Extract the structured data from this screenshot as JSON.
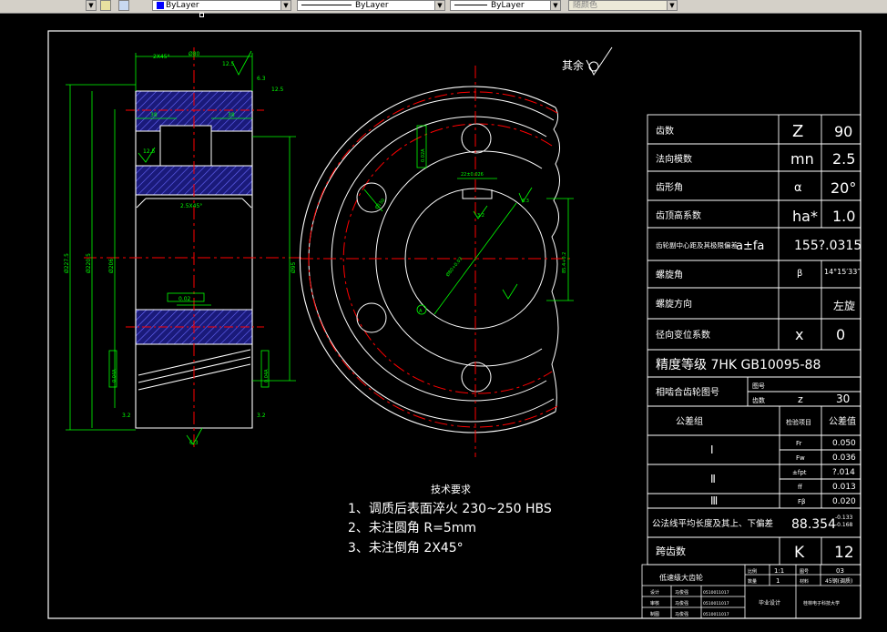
{
  "toolbar": {
    "color_layer": "ByLayer",
    "linetype": "ByLayer",
    "lineweight": "ByLayer",
    "plotstyle": "随颜色"
  },
  "drawing": {
    "surface_symbol_label": "其余",
    "section_dims": {
      "chamfer_top": "2X45°",
      "width_top": "Ø80",
      "rough_top": "12.5",
      "rough_right": "6.3",
      "rough_right2": "12.5",
      "hub_left": "38",
      "hub_right": "38",
      "rough_mid": "12.5",
      "chamfer_inner": "2.5X45°",
      "dia_outer": "Ø227.5",
      "dia_root": "Ø220.5",
      "dia_web": "Ø206",
      "dia_hub": "Ø95",
      "runout_box": "0.02",
      "bottom_rough": "6.3",
      "left_rough": "3.2",
      "right_rough": "3.2",
      "left_tol": "0.04A",
      "right_tol": "0.04A"
    },
    "front_dims": {
      "key_width": "22±0.026",
      "rough_key": "3.2",
      "rough_side": "6.3",
      "hole_dia": "Ø80+0.03",
      "key_depth": "85.4+0.2",
      "datum": "A",
      "hole_pos": "Ø150",
      "tol_box": "0.02A"
    },
    "tech_requirements": {
      "title": "技术要求",
      "items": [
        "1、调质后表面淬火 230~250 HBS",
        "2、未注圆角 R=5mm",
        "3、未注倒角 2X45°"
      ]
    }
  },
  "params_table": {
    "rows": [
      {
        "label": "齿数",
        "symbol": "Z",
        "value": "90"
      },
      {
        "label": "法向模数",
        "symbol": "mn",
        "value": "2.5"
      },
      {
        "label": "齿形角",
        "symbol": "α",
        "value": "20°"
      },
      {
        "label": "齿顶高系数",
        "symbol": "ha*",
        "value": "1.0"
      },
      {
        "label": "齿轮副中心距及其极限偏差",
        "symbol": "a±fa",
        "value": "155?.0315"
      },
      {
        "label": "螺旋角",
        "symbol": "β",
        "value": "14°15′33″"
      },
      {
        "label": "螺旋方向",
        "symbol": "",
        "value": "左旋"
      },
      {
        "label": "径向变位系数",
        "symbol": "x",
        "value": "0"
      }
    ],
    "precision": "精度等级   7HK GB10095-88",
    "mating": {
      "label": "相啮合齿轮图号",
      "sub1": "图号",
      "sub2": "齿数",
      "z": "z",
      "z_value": "30"
    },
    "tolerance_header": {
      "group": "公差组",
      "item": "检验项目",
      "value": "公差值"
    },
    "tolerance_groups": [
      {
        "group": "Ⅰ",
        "items": [
          {
            "item": "Fr",
            "value": "0.050"
          },
          {
            "item": "Fw",
            "value": "0.036"
          }
        ]
      },
      {
        "group": "Ⅱ",
        "items": [
          {
            "item": "±fpt",
            "value": "?.014"
          },
          {
            "item": "ff",
            "value": "0.013"
          }
        ]
      },
      {
        "group": "Ⅲ",
        "items": [
          {
            "item": "Fβ",
            "value": "0.020"
          }
        ]
      }
    ],
    "common_normal": {
      "label": "公法线平均长度及其上、下偏差",
      "value": "88.354",
      "upper": "-0.133",
      "lower": "-0.168"
    },
    "span_teeth": {
      "label": "跨齿数",
      "symbol": "K",
      "value": "12"
    }
  },
  "title_block": {
    "part_name": "低速级大齿轮",
    "scale_label": "比例",
    "scale": "1:1",
    "qty_label": "数量",
    "qty": "1",
    "sheet_label": "图号",
    "sheet": "03",
    "material_label": "材料",
    "material": "45钢(调质)",
    "rows": [
      {
        "role": "设计",
        "name": "马俊强",
        "id": "0510011017"
      },
      {
        "role": "审核",
        "name": "马俊强",
        "id": "0510011017"
      },
      {
        "role": "制图",
        "name": "马俊强",
        "id": "0510011017"
      }
    ],
    "project": "毕业设计",
    "school": "桂林电子科技大学"
  }
}
